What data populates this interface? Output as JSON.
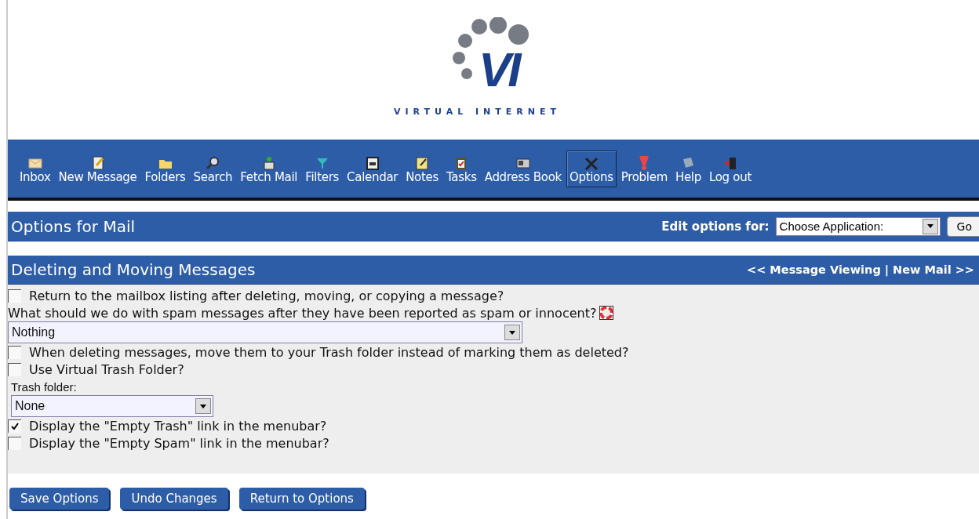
{
  "logo": {
    "mark": "VI",
    "name": "VIRTUAL INTERNET"
  },
  "toolbar": [
    {
      "label": "Inbox",
      "selected": false
    },
    {
      "label": "New Message",
      "selected": false
    },
    {
      "label": "Folders",
      "selected": false
    },
    {
      "label": "Search",
      "selected": false
    },
    {
      "label": "Fetch Mail",
      "selected": false
    },
    {
      "label": "Filters",
      "selected": false
    },
    {
      "label": "Calendar",
      "selected": false
    },
    {
      "label": "Notes",
      "selected": false
    },
    {
      "label": "Tasks",
      "selected": false
    },
    {
      "label": "Address Book",
      "selected": false
    },
    {
      "label": "Options",
      "selected": true
    },
    {
      "label": "Problem",
      "selected": false
    },
    {
      "label": "Help",
      "selected": false
    },
    {
      "label": "Log out",
      "selected": false
    }
  ],
  "page_bar": {
    "title": "Options for Mail",
    "edit_label": "Edit options for:",
    "app_select": "Choose Application:",
    "go": "Go"
  },
  "section": {
    "title": "Deleting and Moving Messages",
    "prev": "<< Message Viewing",
    "separator": "|",
    "next": "New Mail >>"
  },
  "options": [
    {
      "kind": "checkbox",
      "label": "Return to the mailbox listing after deleting, moving, or copying a message?",
      "checked": false
    },
    {
      "kind": "question",
      "label": "What should we do with spam messages after they have been reported as spam or innocent?"
    },
    {
      "kind": "select",
      "value": "Nothing",
      "wide": true
    },
    {
      "kind": "checkbox",
      "label": "When deleting messages, move them to your Trash folder instead of marking them as deleted?",
      "checked": false
    },
    {
      "kind": "checkbox",
      "label": "Use Virtual Trash Folder?",
      "checked": false
    },
    {
      "kind": "label",
      "label": "Trash folder:"
    },
    {
      "kind": "select",
      "value": "None",
      "wide": false
    },
    {
      "kind": "checkbox",
      "label": "Display the \"Empty Trash\" link in the menubar?",
      "checked": true
    },
    {
      "kind": "checkbox",
      "label": "Display the \"Empty Spam\" link in the menubar?",
      "checked": false
    }
  ],
  "buttons": [
    "Save Options",
    "Undo Changes",
    "Return to Options"
  ]
}
